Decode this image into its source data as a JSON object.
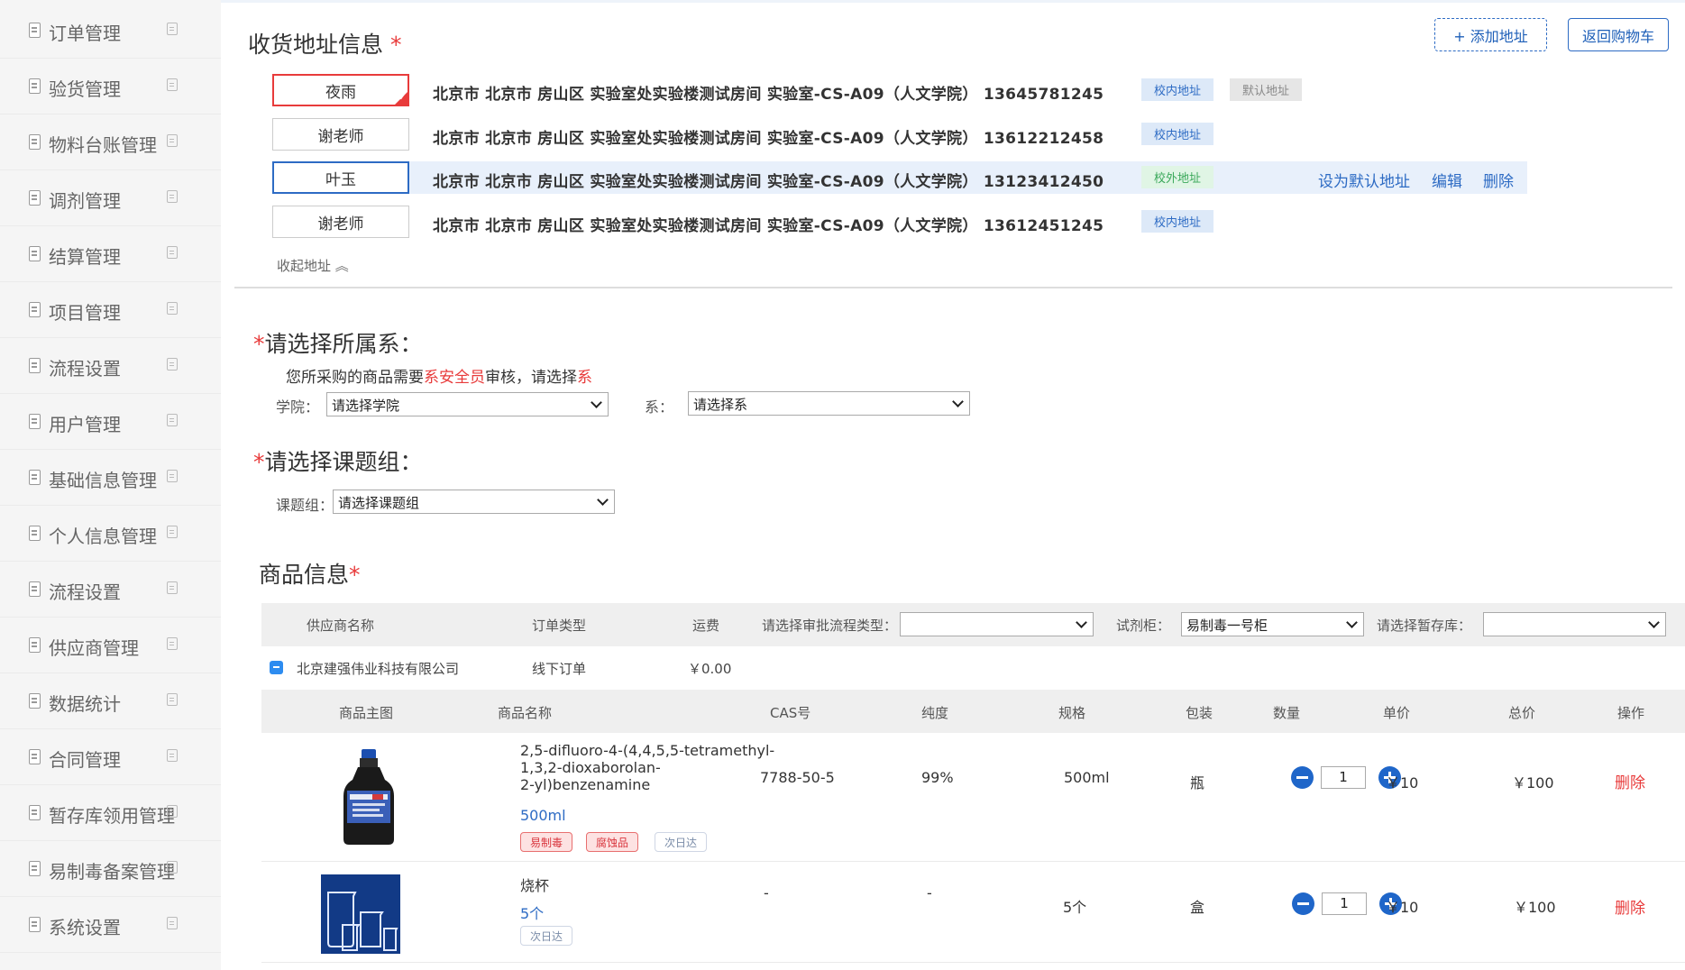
{
  "sidebar": {
    "items": [
      {
        "label": "订单管理"
      },
      {
        "label": "验货管理"
      },
      {
        "label": "物料台账管理"
      },
      {
        "label": "调剂管理"
      },
      {
        "label": "结算管理"
      },
      {
        "label": "项目管理"
      },
      {
        "label": "流程设置"
      },
      {
        "label": "用户管理"
      },
      {
        "label": "基础信息管理"
      },
      {
        "label": "个人信息管理"
      },
      {
        "label": "流程设置"
      },
      {
        "label": "供应商管理"
      },
      {
        "label": "数据统计"
      },
      {
        "label": "合同管理"
      },
      {
        "label": "暂存库领用管理"
      },
      {
        "label": "易制毒备案管理"
      },
      {
        "label": "系统设置"
      }
    ]
  },
  "address": {
    "title": "收货地址信息",
    "required_mark": "*",
    "add_button": "+ 添加地址",
    "back_button": "返回购物车",
    "rows": [
      {
        "name": "夜雨",
        "address": "北京市  北京市  房山区  实验室处实验楼测试房间  实验室-CS-A09（人文学院）  13645781245",
        "tag": "校内地址",
        "default_tag": "默认地址"
      },
      {
        "name": "谢老师",
        "address": "北京市  北京市  房山区  实验室处实验楼测试房间  实验室-CS-A09（人文学院）  13612212458",
        "tag": "校内地址"
      },
      {
        "name": "叶玉",
        "address": "北京市  北京市  房山区  实验室处实验楼测试房间  实验室-CS-A09（人文学院）  13123412450",
        "tag": "校外地址",
        "actions": {
          "set_default": "设为默认地址",
          "edit": "编辑",
          "delete": "删除"
        }
      },
      {
        "name": "谢老师",
        "address": "北京市  北京市  房山区  实验室处实验楼测试房间  实验室-CS-A09（人文学院）  13612451245",
        "tag": "校内地址"
      }
    ],
    "collapse_label": "收起地址"
  },
  "department": {
    "title": "请选择所属系：",
    "required_mark": "*",
    "hint_prefix": "您所采购的商品需要",
    "hint_red1": "系安全员",
    "hint_middle": "审核，请选择",
    "hint_red2": "系",
    "college_label": "学院：",
    "college_value": "请选择学院",
    "dept_label": "系：",
    "dept_value": "请选择系"
  },
  "group": {
    "title": "请选择课题组：",
    "required_mark": "*",
    "label": "课题组：",
    "value": "请选择课题组"
  },
  "goods": {
    "title": "商品信息",
    "required_mark": "*",
    "header1": {
      "supplier": "供应商名称",
      "order_type": "订单类型",
      "freight": "运费",
      "approval_label": "请选择审批流程类型：",
      "approval_value": "",
      "cabinet_label": "试剂柜：",
      "cabinet_value": "易制毒一号柜",
      "storage_label": "请选择暂存库：",
      "storage_value": ""
    },
    "supplier_row": {
      "name": "北京建强伟业科技有限公司",
      "order_type": "线下订单",
      "freight": "￥0.00"
    },
    "header2": {
      "image": "商品主图",
      "name": "商品名称",
      "cas": "CAS号",
      "purity": "纯度",
      "spec": "规格",
      "pack": "包装",
      "qty": "数量",
      "unit_price": "单价",
      "total": "总价",
      "op": "操作"
    },
    "products": [
      {
        "name_lines": [
          "2,5-difluoro-4-(4,4,5,5-tetramethyl-",
          "1,3,2-dioxaborolan-",
          "2-yl)benzenamine"
        ],
        "spec_link": "500ml",
        "tags": [
          "易制毒",
          "腐蚀品",
          "次日达"
        ],
        "cas": "7788-50-5",
        "purity": "99%",
        "spec": "500ml",
        "pack": "瓶",
        "qty": "1",
        "unit_price": "￥10",
        "total": "￥100",
        "op": "删除"
      },
      {
        "name_lines": [
          "烧杯"
        ],
        "spec_link": "5个",
        "tags": [
          "次日达"
        ],
        "cas": "-",
        "purity": "-",
        "spec": "5个",
        "pack": "盒",
        "qty": "1",
        "unit_price": "￥10",
        "total": "￥100",
        "op": "删除"
      }
    ]
  }
}
